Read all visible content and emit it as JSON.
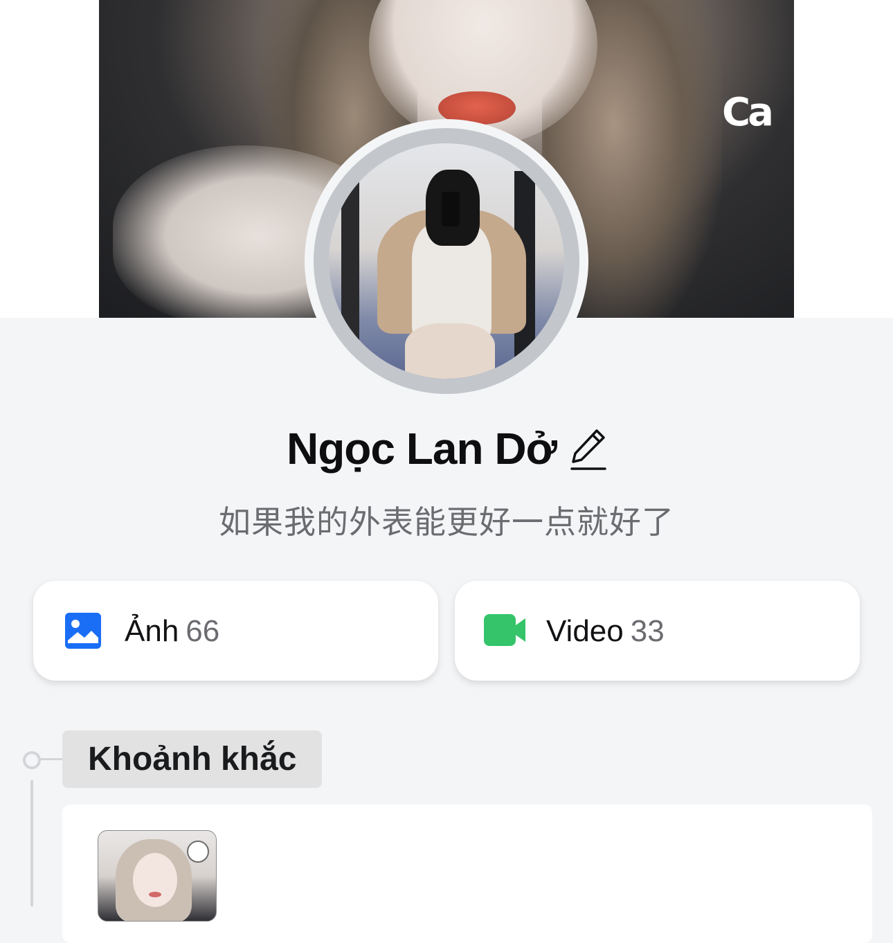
{
  "profile": {
    "name": "Ngọc Lan Dở",
    "bio": "如果我的外表能更好一点就好了",
    "edit_icon": "pencil-icon",
    "cover_text": "Ca"
  },
  "stats": {
    "photos": {
      "label": "Ảnh",
      "count": "66",
      "icon": "image-icon",
      "color": "#1a6ef5"
    },
    "videos": {
      "label": "Video",
      "count": "33",
      "icon": "video-camera-icon",
      "color": "#35c46a"
    }
  },
  "moments": {
    "title": "Khoảnh khắc"
  }
}
